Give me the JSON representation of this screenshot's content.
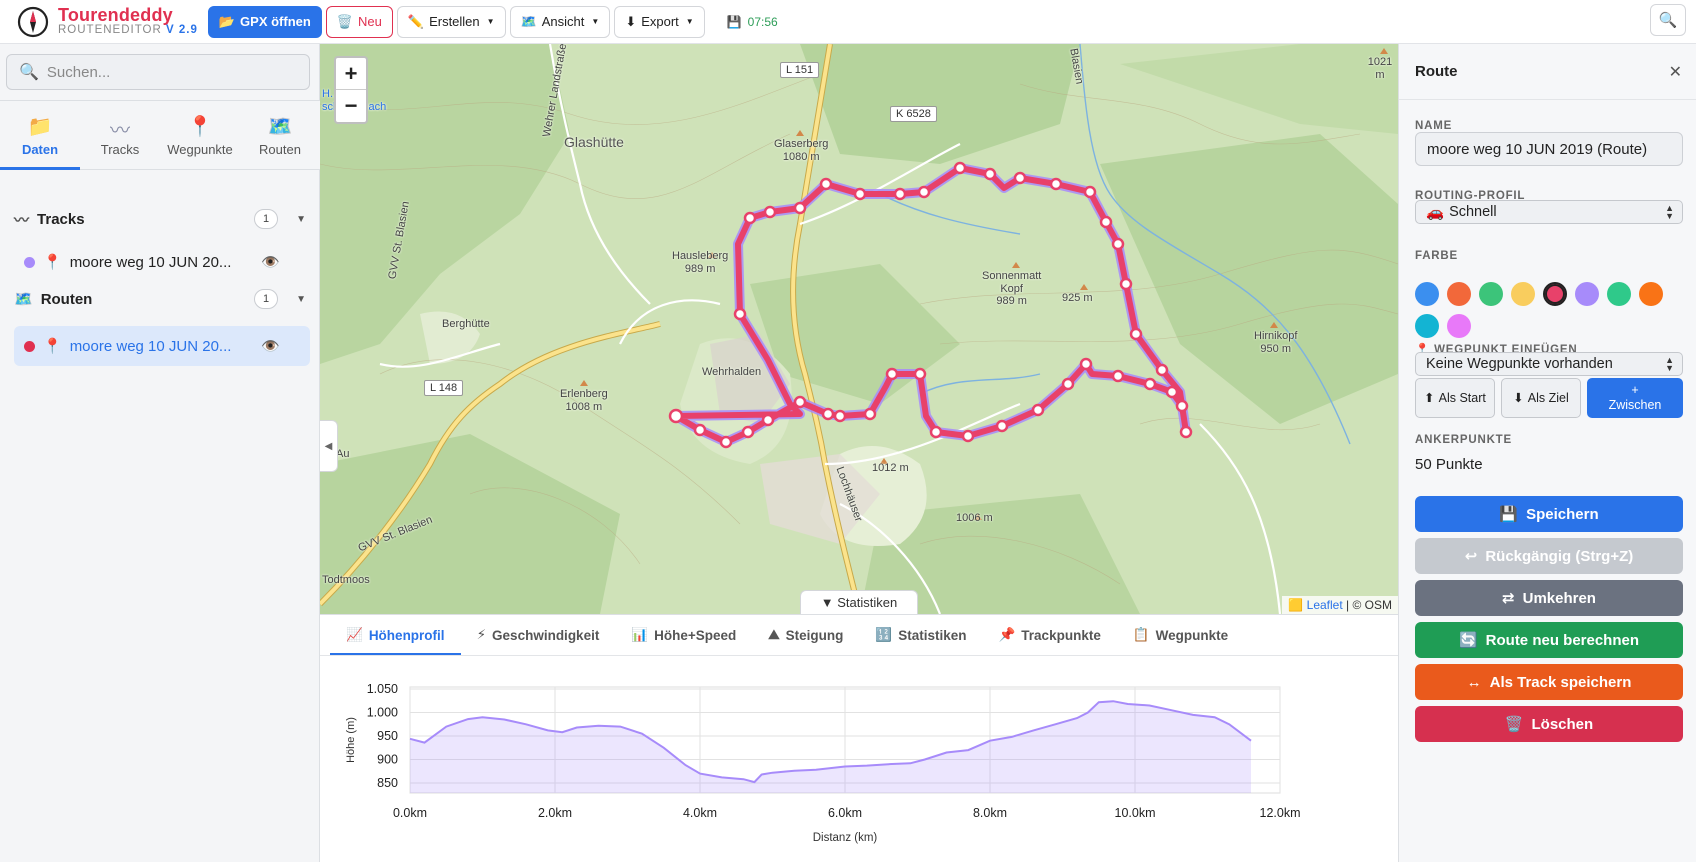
{
  "app": {
    "name": "Tourendeddy",
    "subtitle": "ROUTENEDITOR",
    "version": "V 2.9"
  },
  "toolbar": {
    "gpx_open": "GPX öffnen",
    "new": "Neu",
    "create": "Erstellen",
    "view": "Ansicht",
    "export": "Export",
    "time": "07:56"
  },
  "sidebar": {
    "search_placeholder": "Suchen...",
    "tabs": [
      {
        "label": "Daten",
        "icon": "folder-icon"
      },
      {
        "label": "Tracks",
        "icon": "track-icon"
      },
      {
        "label": "Wegpunkte",
        "icon": "pin-icon"
      },
      {
        "label": "Routen",
        "icon": "map-icon"
      }
    ],
    "tracks_section": {
      "title": "Tracks",
      "count": "1"
    },
    "tracks": [
      {
        "name": "moore weg 10 JUN 20...",
        "color": "#a78bfa"
      }
    ],
    "routes_section": {
      "title": "Routen",
      "count": "1"
    },
    "routes": [
      {
        "name": "moore weg 10 JUN 20...",
        "color": "#e03050"
      }
    ]
  },
  "map": {
    "labels": {
      "glashutte": "Glashütte",
      "glaserberg": "Glaserberg\n1080 m",
      "hausleberg": "Hausleberg\n989 m",
      "sonnenmatt": "Sonnenmatt\nKopf\n989 m",
      "m925": "925 m",
      "hirnikopf": "Hirnikopf\n950 m",
      "berghutte": "Berghütte",
      "wehrhalden": "Wehrhalden",
      "erlenberg": "Erlenberg\n1008 m",
      "m1012": "1012 m",
      "m1006": "1006 m",
      "m1021": "1021 m",
      "au": "Au",
      "gvv": "GVV St. Blasien",
      "gvv2": "GVV St. Blasien",
      "wehrer": "Wehrer Landstraße",
      "todtmoos": "Todtmoos",
      "lochhauser": "Lochhäuser",
      "blasien": "Blasien",
      "htown": "H...\nschwarzbach"
    },
    "shields": {
      "l151": "L 151",
      "k6528": "K 6528",
      "l148": "L 148"
    },
    "attribution": {
      "leaflet": "Leaflet",
      "osm": "| © OSM"
    },
    "stats_toggle": "▼ Statistiken",
    "zoom_in": "+",
    "zoom_out": "−"
  },
  "bottom_tabs": [
    {
      "label": "Höhenprofil",
      "icon": "📈"
    },
    {
      "label": "Geschwindigkeit",
      "icon": "⚡"
    },
    {
      "label": "Höhe+Speed",
      "icon": "📊"
    },
    {
      "label": "Steigung",
      "icon": "⛰"
    },
    {
      "label": "Statistiken",
      "icon": "🔢"
    },
    {
      "label": "Trackpunkte",
      "icon": "📌"
    },
    {
      "label": "Wegpunkte",
      "icon": "📋"
    }
  ],
  "chart_data": {
    "type": "area",
    "title": "",
    "xlabel": "Distanz (km)",
    "ylabel": "Höhe (m)",
    "xlim": [
      0,
      12
    ],
    "ylim": [
      830,
      1050
    ],
    "x_ticks": [
      "0.0km",
      "2.0km",
      "4.0km",
      "6.0km",
      "8.0km",
      "10.0km",
      "12.0km"
    ],
    "y_ticks": [
      "1.050",
      "1.000",
      "950",
      "900",
      "850"
    ],
    "color": "#a78bfa",
    "grid": true,
    "series": [
      {
        "x": [
          0,
          0.2,
          0.5,
          0.8,
          1.0,
          1.3,
          1.6,
          1.9,
          2.1,
          2.3,
          2.6,
          2.9,
          3.2,
          3.5,
          3.8,
          4.0,
          4.3,
          4.6,
          4.75,
          4.85,
          5.0,
          5.3,
          5.6,
          6.0,
          6.3,
          6.6,
          6.9,
          7.1,
          7.4,
          7.7,
          8.0,
          8.3,
          8.6,
          8.9,
          9.2,
          9.35,
          9.5,
          9.7,
          9.9,
          10.2,
          10.5,
          10.8,
          11.1,
          11.3,
          11.6
        ],
        "y": [
          944,
          936,
          970,
          986,
          990,
          985,
          975,
          962,
          958,
          968,
          972,
          970,
          955,
          925,
          888,
          870,
          862,
          858,
          852,
          868,
          872,
          876,
          878,
          885,
          887,
          890,
          892,
          900,
          915,
          920,
          940,
          948,
          962,
          975,
          988,
          1000,
          1022,
          1024,
          1018,
          1015,
          1005,
          995,
          990,
          975,
          940
        ]
      }
    ]
  },
  "panel": {
    "title": "Route",
    "name_label": "NAME",
    "name_value": "moore weg 10 JUN 2019 (Route)",
    "profile_label": "ROUTING-PROFIL",
    "profile_value": "Schnell",
    "color_label": "FARBE",
    "colors": [
      "#3b8fef",
      "#f2683a",
      "#3cc47a",
      "#f9cd5e",
      "#e8416a",
      "#a78bfa",
      "#2fc98a",
      "#f97316",
      "#13b4d3",
      "#e879f9"
    ],
    "selected_color_index": 4,
    "waypoint_label": "WEGPUNKT EINFÜGEN",
    "waypoint_value": "Keine Wegpunkte vorhanden",
    "as_start": "Als Start",
    "as_end": "Als Ziel",
    "between": "Zwischen",
    "anchor_label": "ANKERPUNKTE",
    "anchor_value": "50 Punkte",
    "save": "Speichern",
    "undo": "Rückgängig (Strg+Z)",
    "reverse": "Umkehren",
    "recalc": "Route neu berechnen",
    "save_track": "Als Track speichern",
    "delete": "Löschen",
    "btn_colors": {
      "save": "#2a73e8",
      "undo": "#c5c9cf",
      "reverse": "#6b7280",
      "recalc": "#1f9d55",
      "save_track": "#ea5a1c",
      "delete": "#d6304f"
    }
  }
}
